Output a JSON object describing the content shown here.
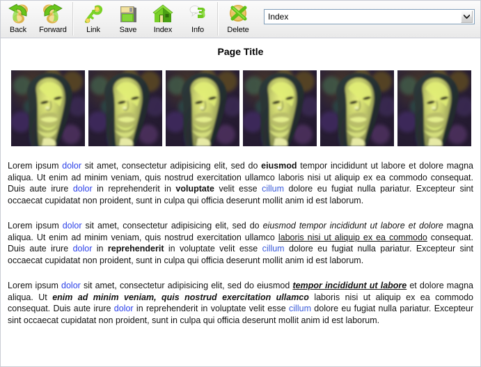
{
  "window": {
    "title": "Page Title"
  },
  "toolbar": {
    "buttons": [
      {
        "label": "Back",
        "icon": "back-arrow-icon"
      },
      {
        "label": "Forward",
        "icon": "forward-arrow-icon"
      },
      {
        "label": "Link",
        "icon": "link-key-icon"
      },
      {
        "label": "Save",
        "icon": "floppy-disk-icon"
      },
      {
        "label": "Index",
        "icon": "house-icon"
      },
      {
        "label": "Info",
        "icon": "info-speech-bubble-icon"
      },
      {
        "label": "Delete",
        "icon": "delete-cross-icon"
      }
    ],
    "dropdown": {
      "name": "index-select",
      "value": "Index",
      "options": [
        "Index"
      ],
      "arrow_icon": "chevron-down-icon"
    }
  },
  "gallery": {
    "count": 6,
    "alt": "face-thumbnail",
    "items": [
      {
        "alt": "face-thumbnail-1"
      },
      {
        "alt": "face-thumbnail-2"
      },
      {
        "alt": "face-thumbnail-3"
      },
      {
        "alt": "face-thumbnail-4"
      },
      {
        "alt": "face-thumbnail-5"
      },
      {
        "alt": "face-thumbnail-6"
      }
    ]
  },
  "paragraphs": {
    "p1": {
      "s1": "Lorem ipsum ",
      "link1": "dolor",
      "s2": " sit amet, consectetur adipisicing elit, sed do ",
      "bold1": "eiusmod",
      "s3": " tempor incididunt ut labore et dolore magna aliqua. Ut enim ad minim veniam, quis nostrud exercitation ullamco laboris nisi ut aliquip ex ea commodo consequat. Duis aute irure ",
      "link2": "dolor",
      "s4": " in reprehenderit in ",
      "bold2": "voluptate",
      "s5": " velit esse ",
      "link3": "cillum",
      "s6": " dolore eu fugiat nulla pariatur. Excepteur sint occaecat cupidatat non proident, sunt in culpa qui officia deserunt mollit anim id est laborum."
    },
    "p2": {
      "s1": "Lorem ipsum ",
      "link1": "dolor",
      "s2": " sit amet, consectetur adipisicing elit, sed do ",
      "italic1": "eiusmod tempor incididunt ut labore et dolore",
      "s3": " magna aliqua. Ut enim ad minim veniam, quis nostrud exercitation ullamco ",
      "underline1": "laboris nisi ut aliquip ex ea commodo",
      "s4": " consequat. Duis aute irure ",
      "link2": "dolor",
      "s5": " in ",
      "bold1": "reprehenderit",
      "s6": " in voluptate velit esse ",
      "link3": "cillum",
      "s7": " dolore eu fugiat nulla pariatur. Excepteur sint occaecat cupidatat non proident, sunt in culpa qui officia deserunt mollit anim id est laborum."
    },
    "p3": {
      "s1": "Lorem ipsum ",
      "link1": "dolor",
      "s2": " sit amet, consectetur adipisicing elit, sed do eiusmod ",
      "biu1": "tempor incididunt ut labore",
      "s3": " et dolore magna aliqua. Ut ",
      "bi1": "enim ad minim veniam, quis nostrud exercitation ullamco",
      "s4": " laboris nisi ut aliquip ex ea commodo consequat. Duis aute irure ",
      "link2": "dolor",
      "s5": " in reprehenderit in voluptate velit esse ",
      "link3": "cillum",
      "s6": " dolore eu fugiat nulla pariatur. Excepteur sint occaecat cupidatat non proident, sunt in culpa qui officia deserunt mollit anim id est laborum."
    }
  },
  "colors": {
    "link": "#2b40e8",
    "link_alt": "#3a5bd9",
    "toolbar_bg": "#f2f2f2",
    "border": "#c9ccd4",
    "icon_green": "#74d21a",
    "icon_gold": "#e8c266"
  }
}
